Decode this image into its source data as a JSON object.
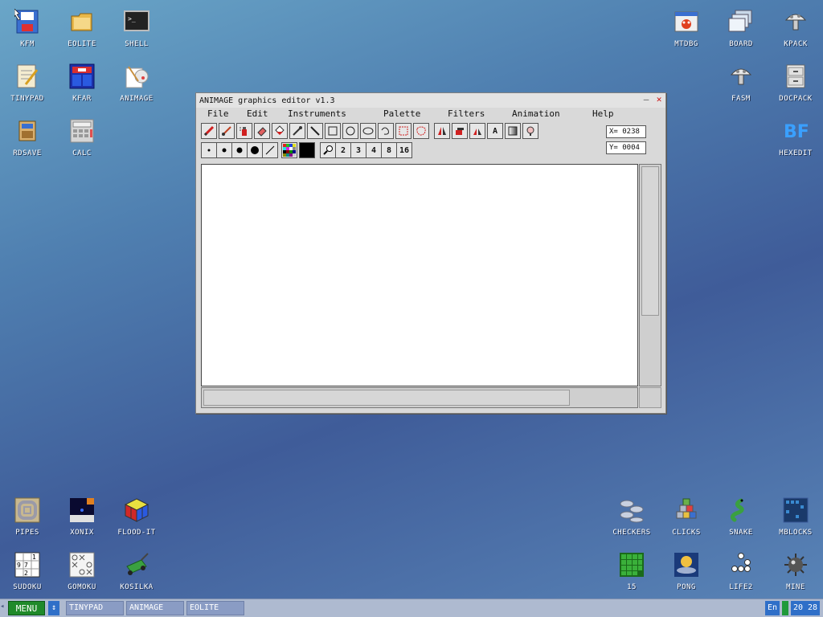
{
  "desktop": {
    "icons": {
      "kfm": "KFM",
      "eolite": "EOLITE",
      "shell": "SHELL",
      "tinypad": "TINYPAD",
      "kfar": "KFAR",
      "animage": "ANIMAGE",
      "rdsave": "RDSAVE",
      "calc": "CALC",
      "mtdbg": "MTDBG",
      "board": "BOARD",
      "kpack": "KPACK",
      "fasm": "FASM",
      "docpack": "DOCPACK",
      "hexedit": "HEXEDIT",
      "pipes": "PIPES",
      "xonix": "XONIX",
      "floodit": "FLOOD-IT",
      "sudoku": "SUDOKU",
      "gomoku": "GOMOKU",
      "kosilka": "KOSILKA",
      "checkers": "CHECKERS",
      "clicks": "CLICKS",
      "snake": "SNAKE",
      "mblocks": "MBLOCKS",
      "fifteen": "15",
      "pong": "PONG",
      "life2": "LIFE2",
      "mine": "MINE"
    }
  },
  "window": {
    "title": "ANIMAGE graphics editor v1.3",
    "minimize_label": "–",
    "close_label": "✕",
    "menu": {
      "file": "File",
      "edit": "Edit",
      "instruments": "Instruments",
      "palette": "Palette",
      "filters": "Filters",
      "animation": "Animation",
      "help": "Help"
    },
    "coords": {
      "x": "X= 0238",
      "y": "Y= 0004"
    },
    "zoom_levels": {
      "z2": "2",
      "z3": "3",
      "z4": "4",
      "z8": "8",
      "z16": "16"
    },
    "text_tool_label": "A"
  },
  "taskbar": {
    "menu_label": "MENU",
    "switch_label": "↕",
    "tasks": {
      "t1": "TINYPAD",
      "t2": "ANIMAGE",
      "t3": "EOLITE"
    },
    "lang": "En",
    "clock": "20 28",
    "left_arrow": "◂"
  },
  "colors": {
    "desktop_top": "#6aa6c8",
    "desktop_mid": "#3f5c99",
    "menu_button": "#1f8a2a",
    "accent_blue": "#2f6fc8",
    "close_red": "#cc1111"
  }
}
